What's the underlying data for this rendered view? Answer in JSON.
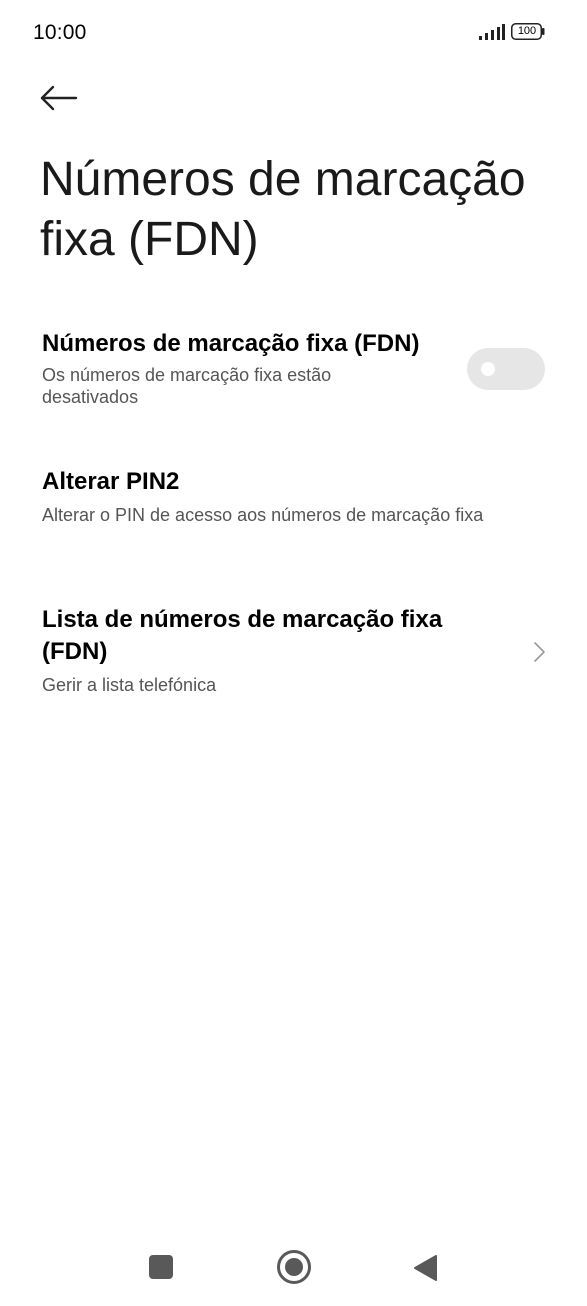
{
  "status_bar": {
    "time": "10:00",
    "battery": "100",
    "icons": [
      "signal-icon",
      "battery-icon"
    ]
  },
  "header": {
    "back_icon": "arrow-left-icon",
    "title": "Números de marcação fixa (FDN)"
  },
  "settings": [
    {
      "title": "Números de marcação fixa (FDN)",
      "summary": "Os números de marcação fixa estão desativados",
      "control": "toggle",
      "enabled": false
    },
    {
      "title": "Alterar PIN2",
      "summary": "Alterar o PIN de acesso aos números de marcação fixa"
    },
    {
      "title": "Lista de números de marcação fixa (FDN)",
      "summary": "Gerir a lista telefónica",
      "control": "chevron-right-icon"
    }
  ],
  "nav_bar": {
    "buttons": [
      "recents-square-icon",
      "home-circle-icon",
      "back-triangle-icon"
    ]
  },
  "colors": {
    "background": "#ffffff",
    "title_text": "#1a1a1a",
    "summary_text": "#555555",
    "toggle_off_track": "#e6e6e6",
    "nav_icons": "#595959"
  }
}
